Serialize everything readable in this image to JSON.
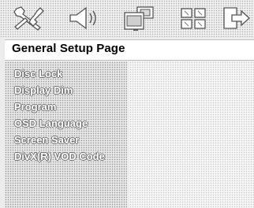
{
  "header": {
    "tabs": [
      {
        "icon": "general-setup-icon"
      },
      {
        "icon": "speaker-icon"
      },
      {
        "icon": "video-setup-icon"
      },
      {
        "icon": "preference-icon"
      },
      {
        "icon": "exit-icon"
      }
    ]
  },
  "page": {
    "title": "General Setup Page"
  },
  "menu": {
    "items": [
      {
        "label": "Disc Lock"
      },
      {
        "label": "Display Dim"
      },
      {
        "label": "Program"
      },
      {
        "label": "OSD Language"
      },
      {
        "label": "Screen Saver"
      },
      {
        "label": "DivX(R) VOD Code"
      }
    ]
  }
}
